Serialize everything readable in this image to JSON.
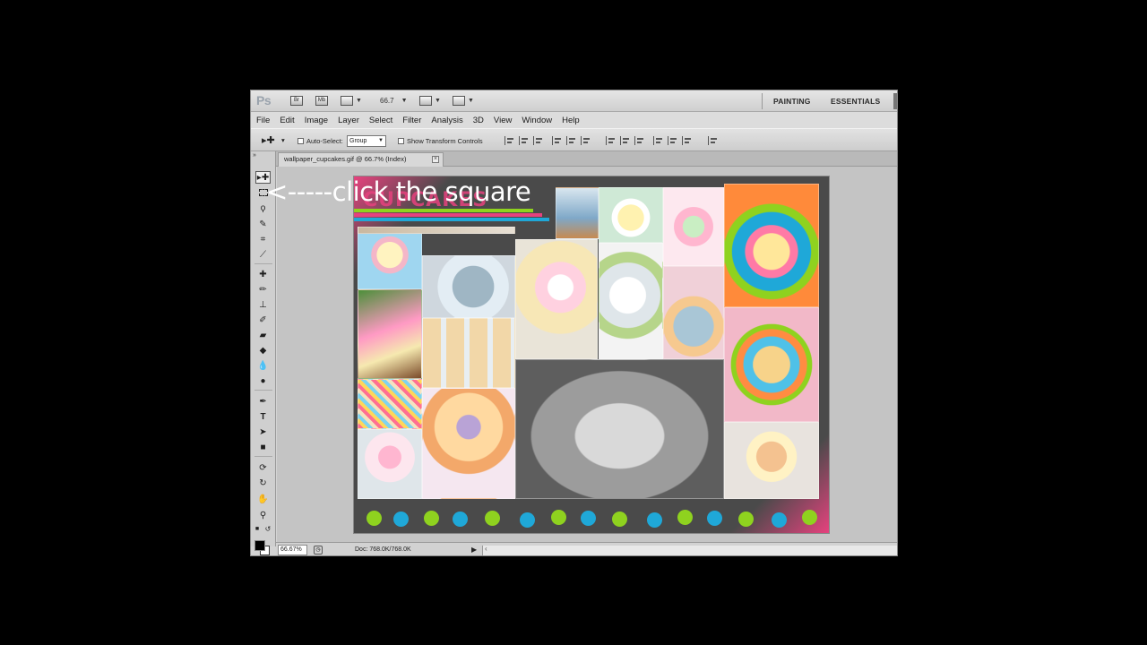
{
  "app": {
    "logo": "Ps",
    "bridge_btn": "Br",
    "minibridge_btn": "Mb",
    "zoom_level": "66.7",
    "workspaces": [
      "PAINTING",
      "ESSENTIALS"
    ]
  },
  "menu": [
    "File",
    "Edit",
    "Image",
    "Layer",
    "Select",
    "Filter",
    "Analysis",
    "3D",
    "View",
    "Window",
    "Help"
  ],
  "options": {
    "auto_select_label": "Auto-Select:",
    "auto_select_value": "Group",
    "show_transform_label": "Show Transform Controls"
  },
  "document": {
    "tab_title": "wallpaper_cupcakes.gif @ 66.7% (Index)",
    "tab_close": "×",
    "art_title": "CUPCAKES"
  },
  "annotation": "<-----click the square",
  "status": {
    "zoom": "66.67%",
    "doc_size": "Doc: 768.0K/768.0K"
  },
  "colors": {
    "accent_pink": "#e6427e",
    "dot_blue": "#1fa8d8",
    "dot_green": "#8fd21f"
  },
  "tools": [
    "move-icon",
    "marquee-icon",
    "lasso-icon",
    "quick-select-icon",
    "crop-icon",
    "eyedropper-icon",
    "healing-icon",
    "brush-icon",
    "stamp-icon",
    "history-brush-icon",
    "eraser-icon",
    "gradient-icon",
    "blur-icon",
    "dodge-icon",
    "pen-icon",
    "type-icon",
    "path-select-icon",
    "shape-icon",
    "3d-rotate-icon",
    "3d-orbit-icon",
    "hand-icon",
    "zoom-icon"
  ]
}
